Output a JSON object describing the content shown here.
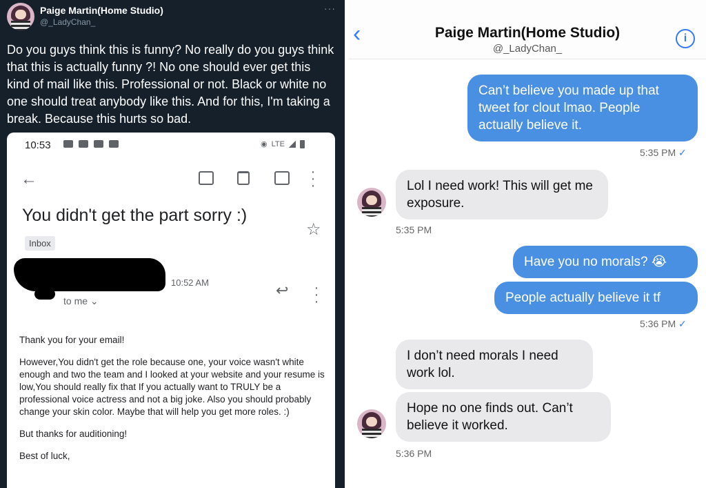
{
  "tweet": {
    "name": "Paige Martin(Home Studio)",
    "handle": "@_LadyChan_",
    "more": "···",
    "text": "Do you guys think this is funny? No really do you guys think that this is actually funny ?! No one should ever get this kind of mail like this. Professional or not. Black or white no one should treat anybody like this. And for this, I'm taking a break. Because this hurts so bad."
  },
  "email": {
    "status_time": "10:53",
    "status_net": "LTE",
    "subject": "You didn't get the part sorry :)",
    "label": "Inbox",
    "time": "10:52 AM",
    "to": "to me ⌄",
    "body": [
      "Thank you for your email!",
      "However,You didn't get the role because one, your voice wasn't white enough and two the team and I looked at your website and your resume is low,You should really fix that If you actually want to TRULY be a professional voice actress and not a big joke. Also you should probably change your skin color. Maybe that will help you get more roles. :)",
      "But thanks for auditioning!",
      "Best of luck,"
    ]
  },
  "chat": {
    "back": "‹",
    "title": "Paige Martin(Home Studio)",
    "handle": "@_LadyChan_",
    "info": "i",
    "messages": {
      "m1": "Can’t believe you made up that tweet for clout lmao. People actually believe it.",
      "t1": "5:35 PM",
      "m2": "Lol I need work! This will get me exposure.",
      "t2": "5:35 PM",
      "m3": "Have you no morals? 😭",
      "m4": "People actually believe it tf",
      "t3": "5:36 PM",
      "m5": "I don’t need morals I need work lol.",
      "m6": "Hope no one finds out. Can’t believe it worked.",
      "t4": "5:36 PM"
    },
    "check": "✓"
  },
  "colors": {
    "twitter_bg": "#15202b",
    "outgoing_bubble": "#4a90e2",
    "incoming_bubble": "#e9e9eb",
    "ios_blue": "#3478f6"
  }
}
